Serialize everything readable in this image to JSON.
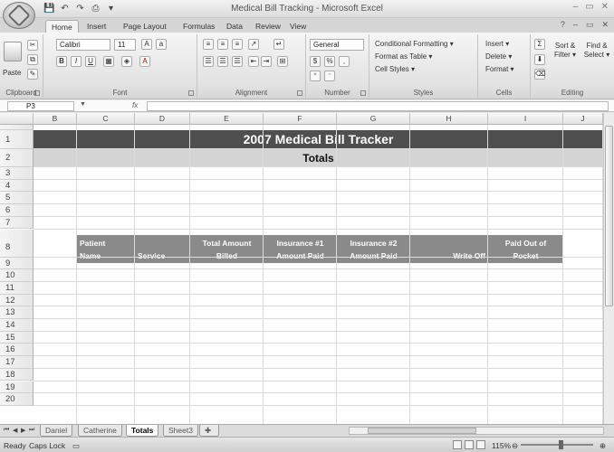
{
  "window": {
    "title": "Medical Bill Tracking - Microsoft Excel",
    "controls": [
      "–",
      "▭",
      "✕"
    ]
  },
  "qat": [
    "💾",
    "↶",
    "↷",
    "⎙",
    "▾"
  ],
  "tabs": [
    "Home",
    "Insert",
    "Page Layout",
    "Formulas",
    "Data",
    "Review",
    "View"
  ],
  "ribbon": {
    "clipboard": {
      "label": "Clipboard",
      "paste": "Paste"
    },
    "font": {
      "label": "Font",
      "name": "Calibri",
      "size": "11",
      "bold": "B",
      "italic": "I",
      "underline": "U"
    },
    "alignment": {
      "label": "Alignment"
    },
    "number": {
      "label": "Number",
      "format": "General",
      "currency": "$",
      "percent": "%",
      "comma": ","
    },
    "styles": {
      "label": "Styles",
      "items": [
        "Conditional Formatting ▾",
        "Format as Table ▾",
        "Cell Styles ▾"
      ]
    },
    "cells": {
      "label": "Cells",
      "items": [
        "Insert ▾",
        "Delete ▾",
        "Format ▾"
      ]
    },
    "editing": {
      "label": "Editing",
      "sum": "Σ",
      "sort": "Sort & Filter ▾",
      "find": "Find & Select ▾"
    }
  },
  "formula_bar": {
    "name_box": "P3",
    "fx": "fx",
    "value": ""
  },
  "columns": [
    "B",
    "C",
    "D",
    "E",
    "F",
    "G",
    "H",
    "I",
    "J"
  ],
  "rows": [
    "1",
    "2",
    "3",
    "4",
    "5",
    "6",
    "7",
    "8",
    "9",
    "10",
    "11",
    "12",
    "13",
    "14",
    "15",
    "16",
    "17",
    "18",
    "19",
    "20"
  ],
  "sheet": {
    "title": "2007 Medical Bill Tracker",
    "subtitle": "Totals",
    "headers": [
      {
        "line1": "Patient",
        "line2": "Name",
        "align": "left"
      },
      {
        "line1": "",
        "line2": "Service",
        "align": "left"
      },
      {
        "line1": "Total Amount",
        "line2": "Billed",
        "align": "center"
      },
      {
        "line1": "Insurance #1",
        "line2": "Amount Paid",
        "align": "center"
      },
      {
        "line1": "Insurance #2",
        "line2": "Amount Paid",
        "align": "center"
      },
      {
        "line1": "",
        "line2": "Write Off",
        "align": "right"
      },
      {
        "line1": "Paid Out of",
        "line2": "Pocket",
        "align": "center"
      }
    ]
  },
  "sheet_tabs": [
    "Daniel",
    "Catherine",
    "Totals",
    "Sheet3"
  ],
  "active_sheet": "Totals",
  "status": {
    "ready": "Ready",
    "caps": "Caps Lock",
    "zoom": "115%"
  }
}
